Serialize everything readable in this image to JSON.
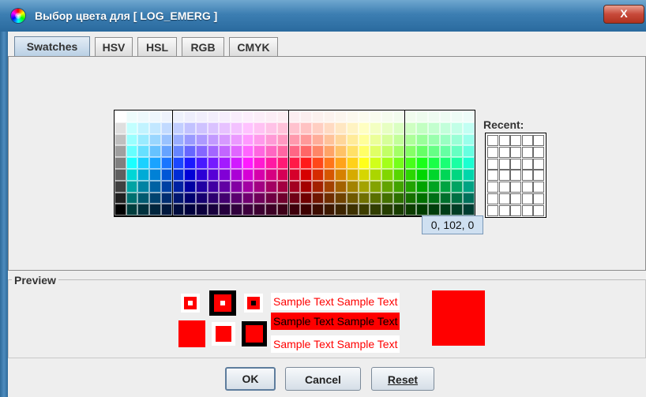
{
  "window": {
    "title": "Выбор цвета для [ LOG_EMERG ]",
    "close_label": "X"
  },
  "tabs": [
    {
      "label": "Swatches",
      "active": true
    },
    {
      "label": "HSV",
      "active": false
    },
    {
      "label": "HSL",
      "active": false
    },
    {
      "label": "RGB",
      "active": false
    },
    {
      "label": "CMYK",
      "active": false
    }
  ],
  "swatches": {
    "recent_label": "Recent:",
    "tooltip": "0, 102, 0"
  },
  "preview": {
    "title": "Preview",
    "sample_text": "Sample Text",
    "color": "#ff0000"
  },
  "buttons": {
    "ok": "OK",
    "cancel": "Cancel",
    "reset": "Reset"
  },
  "colors": {
    "accent": "#ff0000",
    "selection_bg": "#cfe0f1"
  }
}
